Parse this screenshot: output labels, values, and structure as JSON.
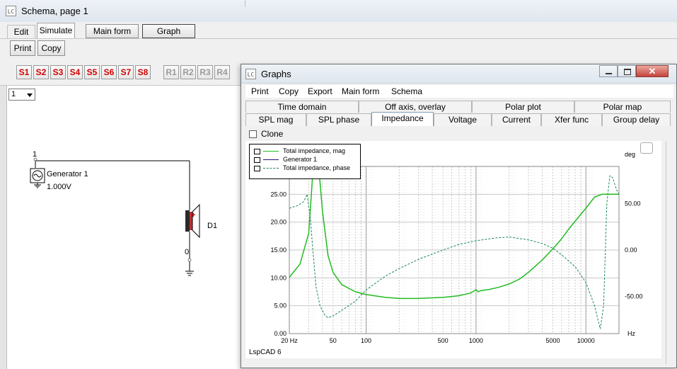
{
  "schema_window": {
    "title": "Schema, page 1",
    "tabs": [
      "Edit",
      "Simulate"
    ],
    "buttons": {
      "main_form": "Main form",
      "graph": "Graph",
      "print": "Print",
      "copy": "Copy"
    },
    "s_buttons": [
      "S1",
      "S2",
      "S3",
      "S4",
      "S5",
      "S6",
      "S7",
      "S8"
    ],
    "r_buttons": [
      "R1",
      "R2",
      "R3",
      "R4"
    ],
    "page_select": "1",
    "node_top": "1",
    "node_bottom": "0",
    "generator_name": "Generator 1",
    "generator_value": "1.000V",
    "driver_label": "D1",
    "plus_sign": "+"
  },
  "graphs_window": {
    "title": "Graphs",
    "menu": [
      "Print",
      "Copy",
      "Export",
      "Main form",
      "Schema"
    ],
    "tabs_row1": [
      "Time domain",
      "Off axis, overlay",
      "Polar plot",
      "Polar map"
    ],
    "tabs_row2": [
      "SPL mag",
      "SPL phase",
      "Impedance",
      "Voltage",
      "Current",
      "Xfer func",
      "Group delay"
    ],
    "active_tab": "Impedance",
    "clone_label": "Clone",
    "footer": "LspCAD 6",
    "colors": {
      "impedance_mag": "#22bb22",
      "generator": "#1a1a7a",
      "impedance_phase": "#1a8a5a",
      "grid": "#c8c8c8",
      "tab_active_border": "#7f9db9"
    }
  },
  "chart_data": {
    "type": "line",
    "xscale": "log",
    "xlim": [
      20,
      20000
    ],
    "ylim": [
      0,
      30
    ],
    "y2lim": [
      -90,
      90
    ],
    "x_tick_labels": [
      "20 Hz",
      "50",
      "100",
      "500",
      "1000",
      "5000",
      "10000"
    ],
    "x_unit": "Hz",
    "y_tick_labels": [
      "0.00",
      "5.00",
      "10.00",
      "15.00",
      "20.00",
      "25.00"
    ],
    "y2_unit": "deg",
    "y2_tick_labels": [
      "50.00",
      "0.00",
      "-50.00"
    ],
    "grid": true,
    "legend_position": "top-left",
    "series": [
      {
        "name": "Total impedance, mag",
        "axis": "left",
        "style": "solid",
        "points": [
          [
            20,
            10.1
          ],
          [
            25,
            12.5
          ],
          [
            30,
            18
          ],
          [
            33,
            30
          ],
          [
            37,
            30
          ],
          [
            40,
            22
          ],
          [
            45,
            14
          ],
          [
            50,
            11
          ],
          [
            60,
            8.8
          ],
          [
            80,
            7.5
          ],
          [
            100,
            7.0
          ],
          [
            150,
            6.5
          ],
          [
            200,
            6.3
          ],
          [
            300,
            6.3
          ],
          [
            500,
            6.5
          ],
          [
            700,
            6.8
          ],
          [
            900,
            7.3
          ],
          [
            1000,
            7.9
          ],
          [
            1050,
            7.5
          ],
          [
            1100,
            7.7
          ],
          [
            1300,
            7.9
          ],
          [
            1600,
            8.3
          ],
          [
            2000,
            8.9
          ],
          [
            2500,
            9.8
          ],
          [
            3000,
            11.0
          ],
          [
            4000,
            13.2
          ],
          [
            5000,
            15.2
          ],
          [
            6000,
            17.0
          ],
          [
            7000,
            18.8
          ],
          [
            8000,
            20.2
          ],
          [
            10000,
            22.5
          ],
          [
            12000,
            24.5
          ],
          [
            14000,
            25.0
          ],
          [
            17000,
            25.0
          ],
          [
            20000,
            25.0
          ]
        ]
      },
      {
        "name": "Generator 1",
        "axis": "left",
        "style": "solid",
        "points": []
      },
      {
        "name": "Total impedance, phase",
        "axis": "right",
        "style": "dashed",
        "points": [
          [
            20,
            45
          ],
          [
            24,
            48
          ],
          [
            27,
            52
          ],
          [
            29,
            60
          ],
          [
            31,
            35
          ],
          [
            33,
            -5
          ],
          [
            35,
            -40
          ],
          [
            38,
            -60
          ],
          [
            42,
            -70
          ],
          [
            45,
            -73
          ],
          [
            50,
            -71
          ],
          [
            60,
            -65
          ],
          [
            80,
            -55
          ],
          [
            100,
            -43
          ],
          [
            150,
            -28
          ],
          [
            200,
            -20
          ],
          [
            300,
            -10
          ],
          [
            500,
            0
          ],
          [
            700,
            6
          ],
          [
            1000,
            10
          ],
          [
            1500,
            13
          ],
          [
            2000,
            14
          ],
          [
            3000,
            11
          ],
          [
            4000,
            7
          ],
          [
            5000,
            2
          ],
          [
            6000,
            -5
          ],
          [
            8000,
            -18
          ],
          [
            10000,
            -35
          ],
          [
            12000,
            -60
          ],
          [
            13500,
            -85
          ],
          [
            14500,
            -60
          ],
          [
            15500,
            50
          ],
          [
            16500,
            80
          ],
          [
            17500,
            78
          ],
          [
            19000,
            65
          ],
          [
            20000,
            60
          ]
        ]
      }
    ]
  }
}
